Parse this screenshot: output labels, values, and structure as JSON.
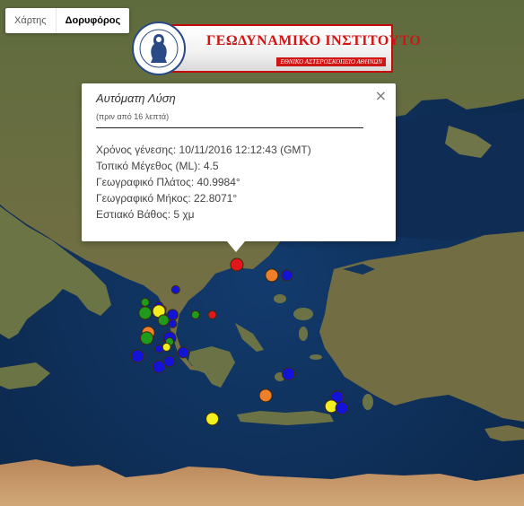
{
  "map_type": {
    "map_label": "Χάρτης",
    "satellite_label": "Δορυφόρος",
    "selected": "satellite"
  },
  "logo": {
    "title": "ΓΕΩΔΥΝΑΜΙΚΟ ΙΝΣΤΙΤΟΥΤΟ",
    "subtitle": "ΕΘΝΙΚΟ ΑΣΤΕΡΟΣΚΟΠΕΙΟ ΑΘΗΝΩΝ",
    "seal_text": "ΕΘΝΙΚΟ ΑΣΤΕΡΟΣΚΟΠΕΙΟ ΑΘΗΝΩΝ · NATIONAL OBSERVATORY OF ATHENS"
  },
  "info_window": {
    "title": "Αυτόματη Λύση",
    "ago": "(πριν από 16 λεπτά)",
    "lines": [
      "Χρόνος γένεσης: 10/11/2016  12:12:43 (GMT)",
      "Τοπικό Μέγεθος (ML): 4.5",
      "Γεωγραφικό Πλάτος: 40.9984°",
      "Γεωγραφικό Μήκος: 22.8071°",
      "Εστιακό Βάθος: 5 χμ"
    ],
    "close_glyph": "×"
  },
  "colors": {
    "red": "#e3171b",
    "orange": "#f07f2a",
    "yellow": "#f3ee1e",
    "green": "#1f9a1a",
    "blue": "#1313d6",
    "sea": "#0d2f5a",
    "land": "#6f7a4a"
  },
  "markers": [
    {
      "lat": 40.9984,
      "lon": 22.8071,
      "color": "red",
      "size": "large",
      "selected": true
    },
    {
      "lat": 40.7,
      "lon": 23.95,
      "color": "orange",
      "size": "large"
    },
    {
      "lat": 40.7,
      "lon": 24.45,
      "color": "blue",
      "size": "medium"
    },
    {
      "lat": 40.3,
      "lon": 20.8,
      "color": "blue",
      "size": "small"
    },
    {
      "lat": 39.95,
      "lon": 19.8,
      "color": "green",
      "size": "small"
    },
    {
      "lat": 39.85,
      "lon": 20.25,
      "color": "blue",
      "size": "small"
    },
    {
      "lat": 39.75,
      "lon": 20.35,
      "color": "red",
      "size": "small"
    },
    {
      "lat": 39.7,
      "lon": 20.25,
      "color": "yellow",
      "size": "large"
    },
    {
      "lat": 39.65,
      "lon": 19.8,
      "color": "green",
      "size": "large"
    },
    {
      "lat": 39.6,
      "lon": 20.7,
      "color": "blue",
      "size": "medium"
    },
    {
      "lat": 39.6,
      "lon": 21.45,
      "color": "green",
      "size": "small"
    },
    {
      "lat": 39.6,
      "lon": 22.0,
      "color": "red",
      "size": "small"
    },
    {
      "lat": 39.45,
      "lon": 20.4,
      "color": "green",
      "size": "medium"
    },
    {
      "lat": 39.35,
      "lon": 20.7,
      "color": "blue",
      "size": "small"
    },
    {
      "lat": 39.1,
      "lon": 19.9,
      "color": "orange",
      "size": "large"
    },
    {
      "lat": 38.95,
      "lon": 19.85,
      "color": "green",
      "size": "large"
    },
    {
      "lat": 38.95,
      "lon": 20.6,
      "color": "blue",
      "size": "large"
    },
    {
      "lat": 38.85,
      "lon": 20.6,
      "color": "green",
      "size": "small"
    },
    {
      "lat": 38.7,
      "lon": 20.5,
      "color": "yellow",
      "size": "small"
    },
    {
      "lat": 38.65,
      "lon": 20.25,
      "color": "blue",
      "size": "small"
    },
    {
      "lat": 38.55,
      "lon": 21.05,
      "color": "blue",
      "size": "medium"
    },
    {
      "lat": 38.45,
      "lon": 19.55,
      "color": "blue",
      "size": "large"
    },
    {
      "lat": 38.3,
      "lon": 20.6,
      "color": "blue",
      "size": "medium"
    },
    {
      "lat": 38.15,
      "lon": 20.25,
      "color": "blue",
      "size": "large"
    },
    {
      "lat": 37.95,
      "lon": 24.5,
      "color": "blue",
      "size": "large"
    },
    {
      "lat": 37.35,
      "lon": 23.75,
      "color": "orange",
      "size": "large"
    },
    {
      "lat": 37.3,
      "lon": 26.1,
      "color": "blue",
      "size": "large"
    },
    {
      "lat": 37.05,
      "lon": 25.9,
      "color": "yellow",
      "size": "large"
    },
    {
      "lat": 37.0,
      "lon": 26.25,
      "color": "blue",
      "size": "large"
    },
    {
      "lat": 36.7,
      "lon": 22.0,
      "color": "yellow",
      "size": "large"
    }
  ]
}
